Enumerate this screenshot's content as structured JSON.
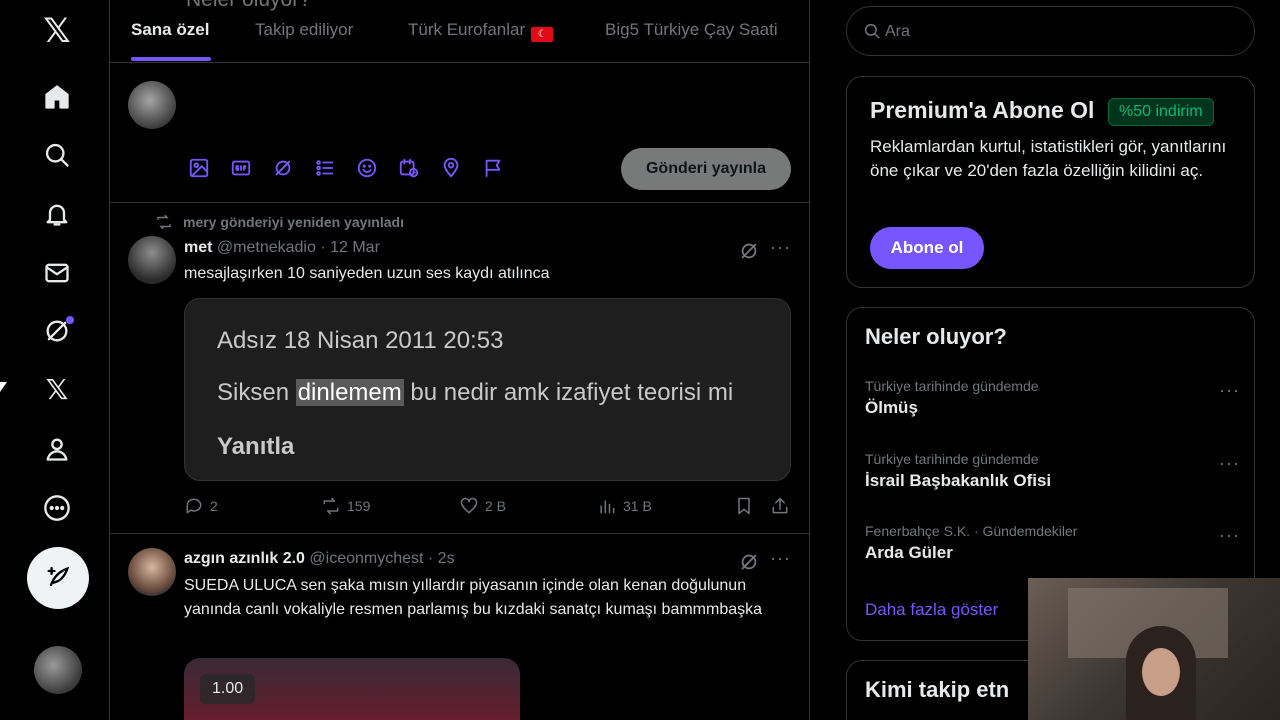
{
  "tabs": [
    {
      "label": "Sana özel",
      "active": true
    },
    {
      "label": "Takip ediliyor",
      "active": false
    },
    {
      "label": "Türk Eurofanlar",
      "active": false
    },
    {
      "label": "Big5 Türkiye Çay Saati",
      "active": false
    }
  ],
  "composer": {
    "placeholder": "Neler oluyor?",
    "post_button": "Gönderi yayınla",
    "tools": [
      "image-icon",
      "gif-icon",
      "grok-icon",
      "poll-icon",
      "emoji-icon",
      "schedule-icon",
      "location-icon",
      "flag-icon"
    ]
  },
  "posts": [
    {
      "repost_label": "mery gönderiyi yeniden yayınladı",
      "name": "met",
      "handle": "@metnekadio",
      "time": "· 12 Mar",
      "text": "mesajlaşırken 10 saniyeden uzun ses kaydı atılınca",
      "media": {
        "line1": "Adsız  18 Nisan 2011 20:53",
        "line2_pre": "Siksen ",
        "line2_highlight": "dinlemem",
        "line2_post": " bu nedir amk izafiyet teorisi mi",
        "line3": "Yanıtla"
      },
      "replies": "2",
      "reposts": "159",
      "likes": "2 B",
      "views": "31 B"
    },
    {
      "name": "azgın azınlık 2.0",
      "handle": "@iceonmychest",
      "time": "· 2s",
      "text": "SUEDA ULUCA sen şaka mısın yıllardır piyasanın içinde olan kenan doğulunun yanında canlı vokaliyle resmen parlamış bu kızdaki sanatçı kumaşı bammmbaşka",
      "video_time": "1.00"
    }
  ],
  "search": {
    "placeholder": "Ara"
  },
  "premium": {
    "title": "Premium'a Abone Ol",
    "badge": "%50 indirim",
    "text": "Reklamlardan kurtul, istatistikleri gör, yanıtlarını öne çıkar ve 20'den fazla özelliğin kilidini aç.",
    "button": "Abone ol"
  },
  "trends": {
    "title": "Neler oluyor?",
    "items": [
      {
        "context": "Türkiye tarihinde gündemde",
        "name": "Ölmüş"
      },
      {
        "context": "Türkiye tarihinde gündemde",
        "name": "İsrail Başbakanlık Ofisi"
      },
      {
        "context": "Fenerbahçe S.K. · Gündemdekiler",
        "name": "Arda Güler"
      }
    ],
    "show_more": "Daha fazla göster"
  },
  "follow": {
    "title": "Kimi takip etn"
  },
  "colors": {
    "accent": "#7856ff",
    "background": "#000000",
    "muted": "#71767b",
    "badge_green": "#00ba7c"
  }
}
